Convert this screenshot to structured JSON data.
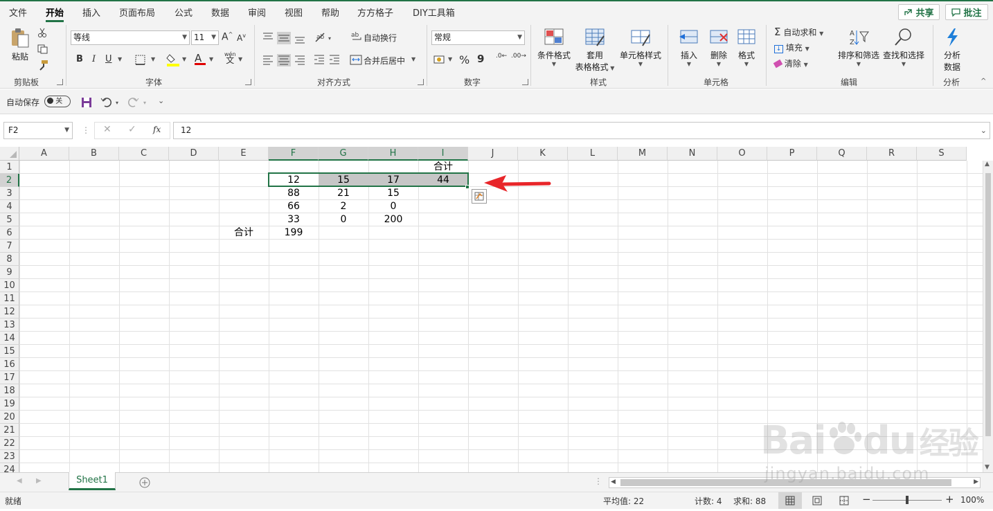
{
  "tabs": [
    "文件",
    "开始",
    "插入",
    "页面布局",
    "公式",
    "数据",
    "审阅",
    "视图",
    "帮助",
    "方方格子",
    "DIY工具箱"
  ],
  "active_tab": "开始",
  "top_buttons": {
    "share": "共享",
    "comment": "批注"
  },
  "ribbon": {
    "clipboard": {
      "paste": "粘贴",
      "label": "剪贴板"
    },
    "font": {
      "name": "等线",
      "size": "11",
      "label": "字体",
      "bold": "B",
      "italic": "I",
      "underline": "U",
      "grow": "A",
      "shrink": "A",
      "font_color": "A",
      "wen": "wén",
      "wen2": "文"
    },
    "alignment": {
      "wrap": "自动换行",
      "merge": "合并后居中",
      "label": "对齐方式"
    },
    "number": {
      "format": "常规",
      "percent": "%",
      "comma": "9",
      "label": "数字",
      "inc": ".0←",
      "dec": ".00→"
    },
    "styles": {
      "conditional": "条件格式",
      "table": "套用",
      "table2": "表格格式",
      "cell_styles": "单元格样式",
      "label": "样式"
    },
    "cells": {
      "insert": "插入",
      "delete": "删除",
      "format": "格式",
      "label": "单元格"
    },
    "editing": {
      "autosum": "自动求和",
      "fill": "填充",
      "clear": "清除",
      "sort": "排序和筛选",
      "find": "查找和选择",
      "label": "编辑"
    },
    "analysis": {
      "btn": "分析",
      "btn2": "数据",
      "label": "分析"
    }
  },
  "qat": {
    "autosave": "自动保存",
    "toggle": "关"
  },
  "formula_bar": {
    "name_box": "F2",
    "fx": "fx",
    "value": "12"
  },
  "columns": [
    "A",
    "B",
    "C",
    "D",
    "E",
    "F",
    "G",
    "H",
    "I",
    "J",
    "K",
    "L",
    "M",
    "N",
    "O",
    "P",
    "Q",
    "R",
    "S"
  ],
  "selected_columns": [
    "F",
    "G",
    "H",
    "I"
  ],
  "rows": [
    "1",
    "2",
    "3",
    "4",
    "5",
    "6",
    "7",
    "8",
    "9",
    "10",
    "11",
    "12",
    "13",
    "14",
    "15",
    "16",
    "17",
    "18",
    "19",
    "20",
    "21",
    "22",
    "23",
    "24"
  ],
  "cells": [
    {
      "ref": "I1",
      "value": "合计"
    },
    {
      "ref": "F2",
      "value": "12"
    },
    {
      "ref": "G2",
      "value": "15"
    },
    {
      "ref": "H2",
      "value": "17"
    },
    {
      "ref": "I2",
      "value": "44"
    },
    {
      "ref": "F3",
      "value": "88"
    },
    {
      "ref": "G3",
      "value": "21"
    },
    {
      "ref": "H3",
      "value": "15"
    },
    {
      "ref": "F4",
      "value": "66"
    },
    {
      "ref": "G4",
      "value": "2"
    },
    {
      "ref": "H4",
      "value": "0"
    },
    {
      "ref": "F5",
      "value": "33"
    },
    {
      "ref": "G5",
      "value": "0"
    },
    {
      "ref": "H5",
      "value": "200"
    },
    {
      "ref": "E6",
      "value": "合计"
    },
    {
      "ref": "F6",
      "value": "199"
    }
  ],
  "sheet_tab": "Sheet1",
  "status": {
    "ready": "就绪",
    "average": "平均值: 22",
    "count": "计数: 4",
    "sum": "求和: 88",
    "zoom": "100%"
  },
  "watermark": {
    "line1": "Bai",
    "line1b": "du",
    "line1c": "经验",
    "line2": "jingyan.baidu.com"
  },
  "colors": {
    "accent": "#217346",
    "arrow": "#e8262a"
  }
}
